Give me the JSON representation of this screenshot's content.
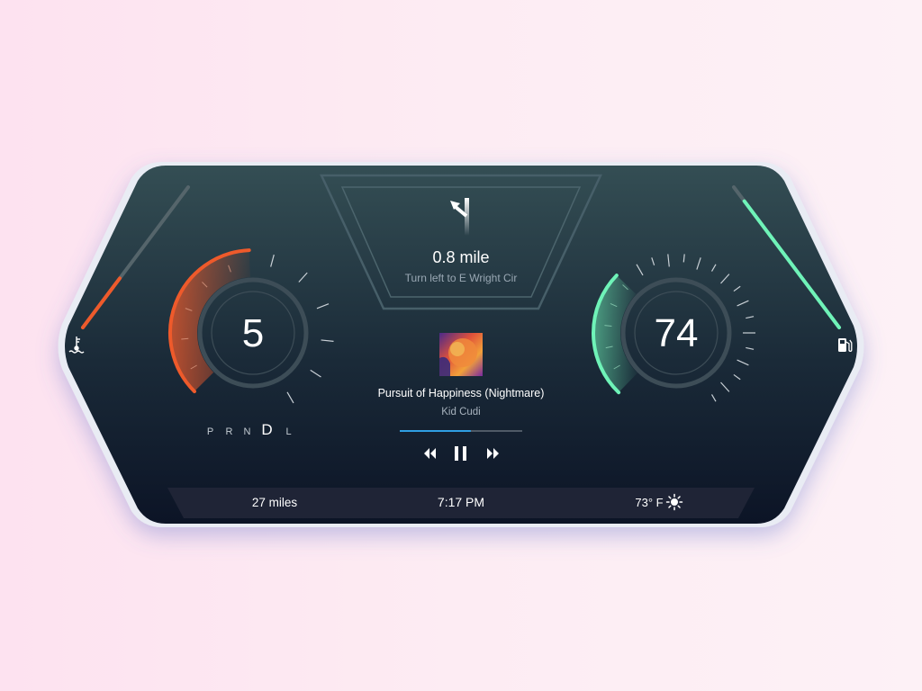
{
  "colors": {
    "background_left": "#fde2f0",
    "panel_top": "#344e54",
    "panel_bottom": "#0c1426",
    "accent_orange": "#ee5a2b",
    "accent_green": "#6ff3b8",
    "accent_blue": "#2f9fe3"
  },
  "navigation": {
    "distance": "0.8 mile",
    "instruction": "Turn left to E Wright Cir",
    "icon": "turn-left-arrow-icon"
  },
  "left_gauge": {
    "value": "5",
    "arc_fraction": 0.42,
    "gears": [
      "P",
      "R",
      "N",
      "D",
      "L"
    ],
    "selected_gear": "D"
  },
  "right_gauge": {
    "value": "74",
    "arc_fraction": 0.3
  },
  "temperature_bar": {
    "level": 0.35,
    "icon": "coolant-temperature-icon"
  },
  "fuel_bar": {
    "level": 0.9,
    "icon": "fuel-pump-icon"
  },
  "media": {
    "title": "Pursuit of Happiness (Nightmare)",
    "artist": "Kid Cudi",
    "progress": 0.58,
    "controls": {
      "previous": "rewind-icon",
      "play_pause": "pause-icon",
      "next": "fast-forward-icon"
    }
  },
  "status_bar": {
    "range": "27 miles",
    "time": "7:17 PM",
    "weather": "73° F",
    "weather_icon": "sun-icon"
  }
}
